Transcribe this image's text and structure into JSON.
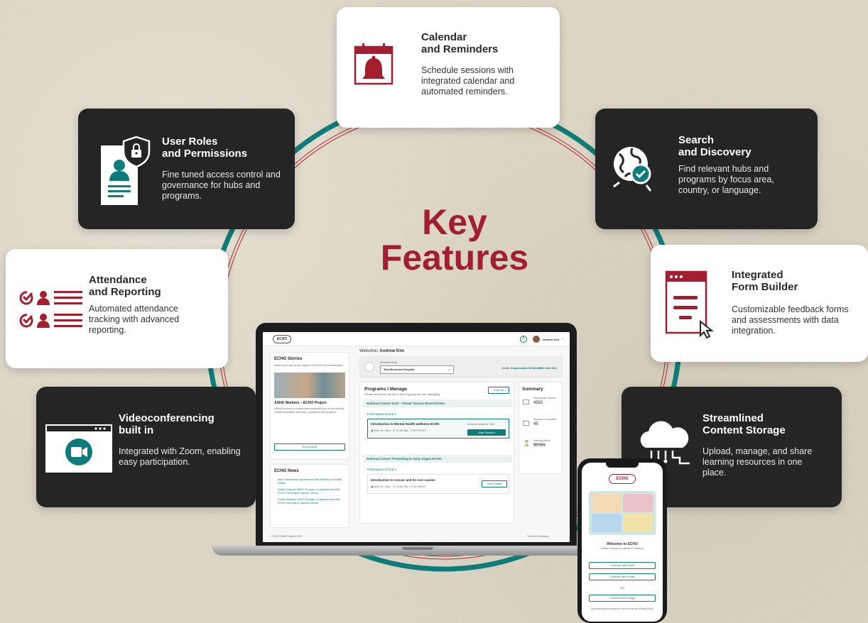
{
  "title": {
    "line1": "Key",
    "line2": "Features"
  },
  "colors": {
    "accent_red": "#a21f30",
    "teal": "#0e7c7b",
    "dark_card": "#252525",
    "light_card": "#ffffff"
  },
  "features": {
    "calendar": {
      "title1": "Calendar",
      "title2": "and Reminders",
      "desc": "Schedule sessions with integrated calendar and automated reminders.",
      "icon": "calendar-bell-icon"
    },
    "roles": {
      "title1": "User Roles",
      "title2": "and Permissions",
      "desc": "Fine tuned access control and governance for hubs and programs.",
      "icon": "user-shield-icon"
    },
    "search": {
      "title1": "Search",
      "title2": "and Discovery",
      "desc": "Find relevant hubs and programs by focus area, country, or language.",
      "icon": "globe-search-icon"
    },
    "attendance": {
      "title1": "Attendance",
      "title2": "and Reporting",
      "desc": "Automated attendance tracking with advanced reporting.",
      "icon": "attendance-check-icon"
    },
    "forms": {
      "title1": "Integrated",
      "title2": "Form Builder",
      "desc": "Customizable feedback forms and assessments with data integration.",
      "icon": "form-builder-icon"
    },
    "video": {
      "title1": "Videoconferencing",
      "title2": "built in",
      "desc": "Integrated with Zoom, enabling easy participation.",
      "icon": "video-camera-icon"
    },
    "storage": {
      "title1": "Streamlined",
      "title2": "Content Storage",
      "desc": "Upload, manage, and share learning resources in one place.",
      "icon": "cloud-upload-icon"
    }
  },
  "laptop": {
    "logo": "ECHO",
    "user": "Andrew Kim",
    "welcome_prefix": "Welcome, ",
    "welcome_name": "Andrew Kim",
    "stories": {
      "title": "ECHO Stories",
      "subtitle": "Read more about the impact of ECHO on communities.",
      "story_title": "ASHA Workers – ECHO Project",
      "story_text": "ASHA workers in India share experiences of community health education and care, guidance and support.",
      "button": "Know More"
    },
    "news": {
      "title": "ECHO News",
      "items": [
        "New Partnership agreement with Ministry of Health Affairs",
        "United Nations WHO Program in partnership with ECHO running in Zambia, Africa",
        "United Nations WHO Program in partnership with ECHO running in Zambia, Africa"
      ]
    },
    "hub": {
      "label": "Selected Hub",
      "value": "Tata Memorial Hospital",
      "link1": "Invite Organization Members",
      "link2": "Edit Hub Info"
    },
    "programs": {
      "title": "Programs I Manage",
      "subtitle": "Please find below the list of the programs you are managing",
      "view_all": "View All",
      "program1": "National Cancer Grid – Virtual Tumour Board ECHO",
      "group1": "Participants Group 1",
      "session1_title": "Introduction to Mental Health wellness ECHO",
      "session1_date": "Mar 10, 2021",
      "session1_time": "11:30 AM - 1:30 PM IST",
      "session1_status": "Session starts in 20m",
      "start_button": "Start Session",
      "program2": "National Cancer Preventing in early stages ECHO",
      "group2": "Participants Group 2",
      "session2_title": "Introduction to Cancer and its root causes",
      "session2_date": "Mar 10, 2021",
      "session2_time": "03:00 PM - 4:30 PM IST",
      "detail_button": "View Detail"
    },
    "summary": {
      "title": "Summary",
      "items": [
        {
          "label": "Participants Trained",
          "value": "4592"
        },
        {
          "label": "Sessions Conducted",
          "value": "45"
        },
        {
          "label": "Learning Hours Completed",
          "value": "90 hrs"
        }
      ]
    },
    "footer_left": "© 2021 UNM Project ECHO",
    "footer_right": "Terms & Conditions"
  },
  "phone": {
    "logo": "ECHO",
    "welcome": "Welcome to ECHO",
    "subtitle": "Please choose an option to continue",
    "btn_email": "Continue with Email",
    "btn_mobile": "Continue with Mobile",
    "or": "OR",
    "btn_google": "Continue with Google",
    "terms": "By continuing you accept the Terms of Use and Privacy Policy"
  }
}
